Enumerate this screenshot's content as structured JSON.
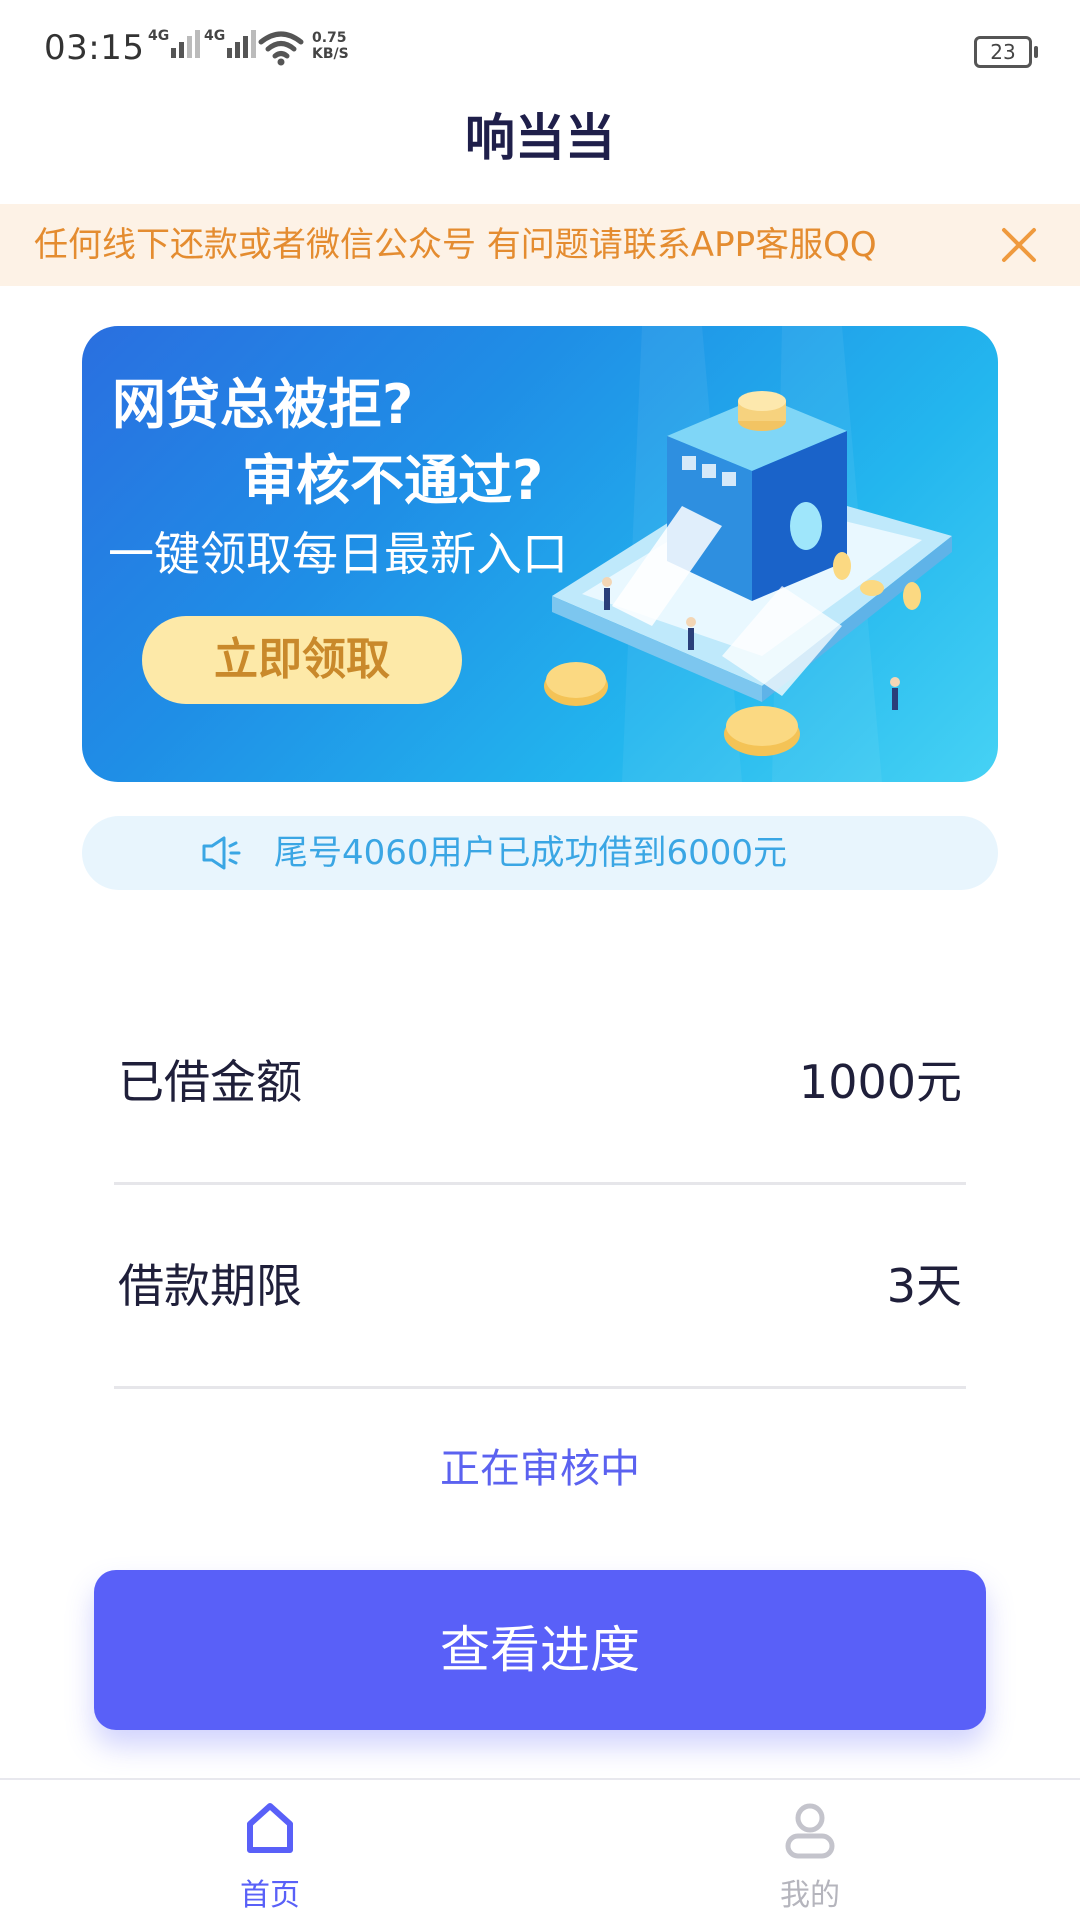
{
  "status_bar": {
    "time": "03:15",
    "signal1_type": "4G",
    "signal2_type": "4G",
    "net_speed_value": "0.75",
    "net_speed_unit": "KB/S",
    "battery": "23"
  },
  "header": {
    "title": "响当当"
  },
  "notice": {
    "text": "任何线下还款或者微信公众号  有问题请联系APP客服QQ"
  },
  "banner": {
    "line1": "网贷总被拒?",
    "line2": "审核不通过?",
    "line3": "一键领取每日最新入口",
    "button_label": "立即领取"
  },
  "ticker": {
    "text": "尾号4060用户已成功借到6000元"
  },
  "loan_info": {
    "amount_label": "已借金额",
    "amount_value": "1000元",
    "term_label": "借款期限",
    "term_value": "3天"
  },
  "status": {
    "text": "正在审核中"
  },
  "action": {
    "button_label": "查看进度"
  },
  "bottom_nav": {
    "items": [
      {
        "label": "首页",
        "icon": "home-icon",
        "active": true
      },
      {
        "label": "我的",
        "icon": "user-icon",
        "active": false
      }
    ]
  },
  "colors": {
    "accent": "#5960f8",
    "notice_bg": "#fdf2e6",
    "notice_text": "#e48c30",
    "ticker_text": "#3aa6e4"
  }
}
